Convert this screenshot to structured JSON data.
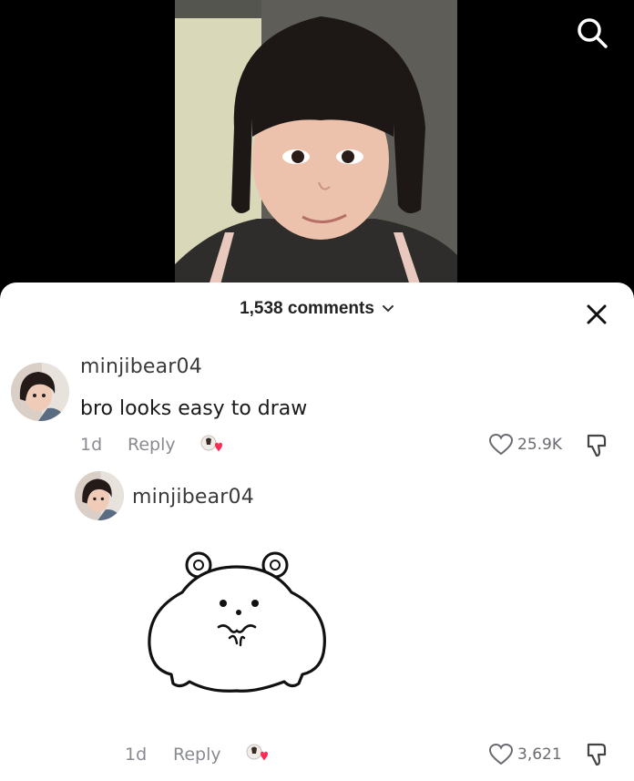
{
  "header": {
    "comment_count": "1,538 comments"
  },
  "comments": [
    {
      "username": "minjibear04",
      "text": "bro looks easy to draw",
      "time": "1d",
      "reply_label": "Reply",
      "likes": "25.9K"
    },
    {
      "username": "minjibear04",
      "text": "",
      "time": "1d",
      "reply_label": "Reply",
      "likes": "3,621",
      "attachment": "hamster-sticker"
    }
  ],
  "icons": {
    "search": "search-icon",
    "close": "close-icon",
    "chevron": "chevron-down-icon",
    "heart": "heart-icon",
    "dislike": "dislike-icon",
    "creator_liked": "creator-liked-icon"
  },
  "colors": {
    "sheet_bg": "#ffffff",
    "text": "#1a1a1a",
    "muted": "#8a8b91",
    "accent_heart": "#fe2c55"
  }
}
